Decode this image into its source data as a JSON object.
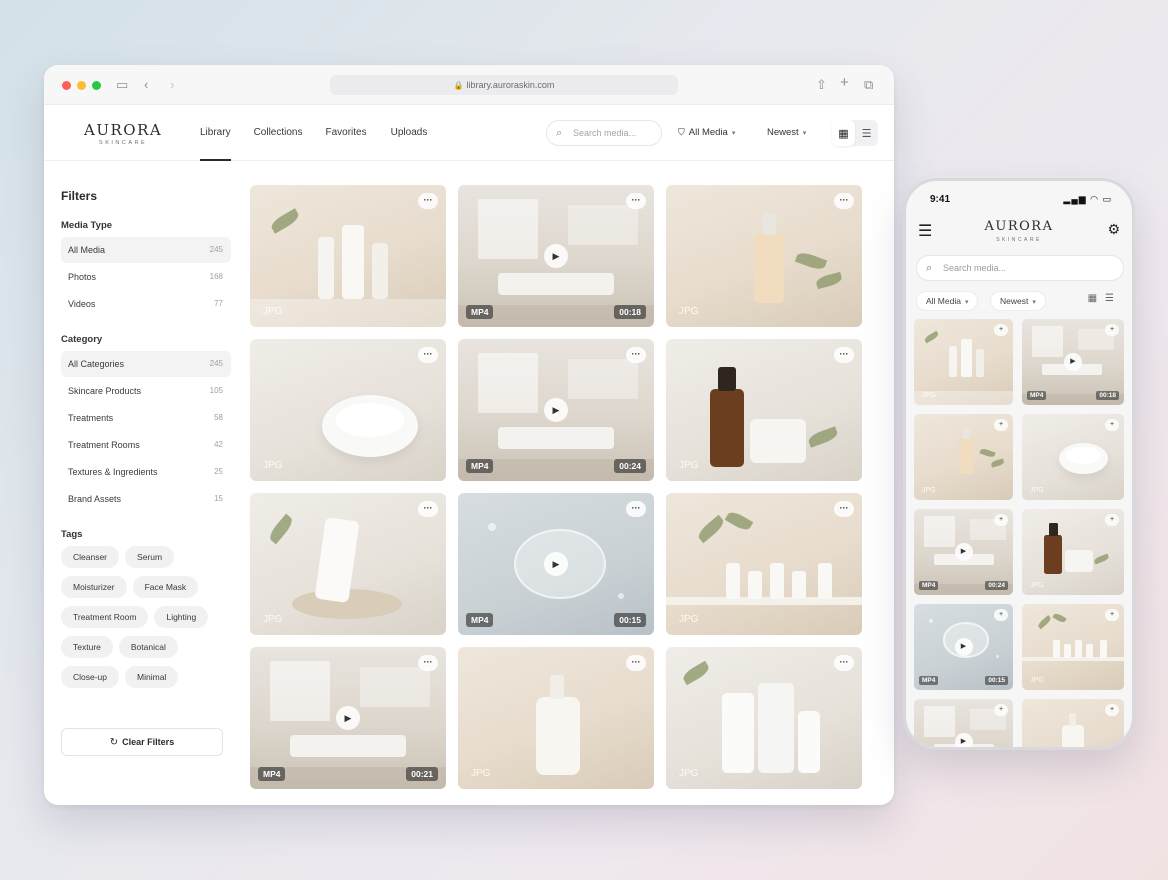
{
  "browser": {
    "url": "library.auroraskin.com",
    "traffic_colors": [
      "#ff5f57",
      "#febc2e",
      "#28c840"
    ]
  },
  "brand": {
    "name": "AURORA",
    "tagline": "SKINCARE"
  },
  "nav": {
    "tabs": [
      {
        "label": "Library",
        "active": true
      },
      {
        "label": "Collections",
        "active": false
      },
      {
        "label": "Favorites",
        "active": false
      },
      {
        "label": "Uploads",
        "active": false
      }
    ]
  },
  "toolbar": {
    "search_placeholder": "Search media...",
    "filter_label": "All Media",
    "sort_label": "Newest"
  },
  "sidebar": {
    "title": "Filters",
    "media_type_heading": "Media Type",
    "media_types": [
      {
        "label": "All Media",
        "count": "245",
        "active": true
      },
      {
        "label": "Photos",
        "count": "168",
        "active": false
      },
      {
        "label": "Videos",
        "count": "77",
        "active": false
      }
    ],
    "category_heading": "Category",
    "categories": [
      {
        "label": "All Categories",
        "count": "245",
        "active": true
      },
      {
        "label": "Skincare Products",
        "count": "105",
        "active": false
      },
      {
        "label": "Treatments",
        "count": "58",
        "active": false
      },
      {
        "label": "Treatment Rooms",
        "count": "42",
        "active": false
      },
      {
        "label": "Textures & Ingredients",
        "count": "25",
        "active": false
      },
      {
        "label": "Brand Assets",
        "count": "15",
        "active": false
      }
    ],
    "tags_heading": "Tags",
    "tags": [
      "Cleanser",
      "Serum",
      "Moisturizer",
      "Face Mask",
      "Treatment Room",
      "Lighting",
      "Texture",
      "Botanical",
      "Close-up",
      "Minimal"
    ],
    "clear_label": "Clear Filters"
  },
  "media": [
    {
      "kind": "photo",
      "format": "JPG",
      "duration": "",
      "scene": "bottles"
    },
    {
      "kind": "video",
      "format": "MP4",
      "duration": "00:18",
      "scene": "room"
    },
    {
      "kind": "photo",
      "format": "JPG",
      "duration": "",
      "scene": "serum"
    },
    {
      "kind": "photo",
      "format": "JPG",
      "duration": "",
      "scene": "cream"
    },
    {
      "kind": "video",
      "format": "MP4",
      "duration": "00:24",
      "scene": "room"
    },
    {
      "kind": "photo",
      "format": "JPG",
      "duration": "",
      "scene": "amber"
    },
    {
      "kind": "photo",
      "format": "JPG",
      "duration": "",
      "scene": "tube"
    },
    {
      "kind": "video",
      "format": "MP4",
      "duration": "00:15",
      "scene": "water"
    },
    {
      "kind": "photo",
      "format": "JPG",
      "duration": "",
      "scene": "shelf"
    },
    {
      "kind": "video",
      "format": "MP4",
      "duration": "00:21",
      "scene": "room"
    },
    {
      "kind": "photo",
      "format": "JPG",
      "duration": "",
      "scene": "pump"
    },
    {
      "kind": "photo",
      "format": "JPG",
      "duration": "",
      "scene": "tubes"
    }
  ],
  "phone": {
    "time": "9:41",
    "search_placeholder": "Search media...",
    "filter_label": "All Media",
    "sort_label": "Newest",
    "media": [
      {
        "kind": "photo",
        "format": "JPG",
        "duration": "",
        "scene": "bottles"
      },
      {
        "kind": "video",
        "format": "MP4",
        "duration": "00:18",
        "scene": "room"
      },
      {
        "kind": "photo",
        "format": "JPG",
        "duration": "",
        "scene": "serum"
      },
      {
        "kind": "photo",
        "format": "JPG",
        "duration": "",
        "scene": "cream"
      },
      {
        "kind": "video",
        "format": "MP4",
        "duration": "00:24",
        "scene": "room"
      },
      {
        "kind": "photo",
        "format": "JPG",
        "duration": "",
        "scene": "amber"
      },
      {
        "kind": "video",
        "format": "MP4",
        "duration": "00:15",
        "scene": "water"
      },
      {
        "kind": "photo",
        "format": "JPG",
        "duration": "",
        "scene": "shelf"
      },
      {
        "kind": "video",
        "format": "",
        "duration": "",
        "scene": "room"
      },
      {
        "kind": "photo",
        "format": "",
        "duration": "",
        "scene": "pump"
      }
    ]
  },
  "icons": {
    "lock": "lock-icon",
    "search": "search-icon",
    "more": "more-icon",
    "play": "play-icon",
    "grid_view": "grid-view-icon",
    "list_view": "list-view-icon",
    "refresh": "refresh-icon",
    "menu": "menu-icon",
    "tune": "tune-icon"
  }
}
